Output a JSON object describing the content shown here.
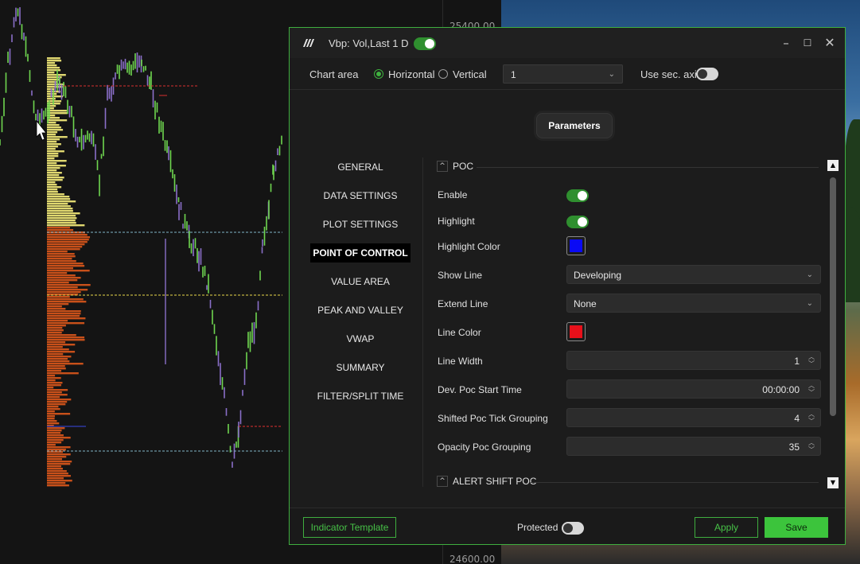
{
  "price_axis": {
    "top_label": "25400.00",
    "bottom_label": "24600.00"
  },
  "dialog": {
    "title": "Vbp: Vol,Last 1 D",
    "title_toggle_on": true,
    "window_controls": {
      "minimize": "–",
      "maximize": "☐",
      "close": "✕"
    },
    "chart_area": {
      "label": "Chart area",
      "orientation_options": [
        "Horizontal",
        "Vertical"
      ],
      "selected_orientation": "Horizontal",
      "area_select_value": "1",
      "use_sec_axis_label": "Use sec. axis",
      "use_sec_axis_on": false
    },
    "parameters_button": "Parameters",
    "nav": {
      "items": [
        "GENERAL",
        "DATA SETTINGS",
        "PLOT SETTINGS",
        "POINT OF CONTROL",
        "VALUE AREA",
        "PEAK AND VALLEY",
        "VWAP",
        "SUMMARY",
        "FILTER/SPLIT TIME"
      ],
      "active": "POINT OF CONTROL"
    },
    "poc_section": {
      "title": "POC",
      "enable": {
        "label": "Enable",
        "on": true
      },
      "highlight": {
        "label": "Highlight",
        "on": true
      },
      "highlight_color": {
        "label": "Highlight Color",
        "color": "#0a0af5"
      },
      "show_line": {
        "label": "Show Line",
        "value": "Developing"
      },
      "extend_line": {
        "label": "Extend Line",
        "value": "None"
      },
      "line_color": {
        "label": "Line Color",
        "color": "#e8101a"
      },
      "line_width": {
        "label": "Line Width",
        "value": "1"
      },
      "dev_poc_start_time": {
        "label": "Dev. Poc Start Time",
        "value": "00:00:00"
      },
      "shifted_poc_tick_grouping": {
        "label": "Shifted Poc Tick Grouping",
        "value": "4"
      },
      "opacity_poc_grouping": {
        "label": "Opacity Poc Grouping",
        "value": "35"
      }
    },
    "alert_section": {
      "title": "ALERT SHIFT POC"
    },
    "footer": {
      "indicator_template": "Indicator Template",
      "protected_label": "Protected",
      "protected_on": false,
      "apply": "Apply",
      "save": "Save"
    }
  },
  "colors": {
    "accent_green": "#3fae3f",
    "save_green": "#3cc43c",
    "profile_yellow": "#e0d870",
    "profile_orange": "#c8501a",
    "candle_green": "#6fd64f",
    "candle_purple": "#8a6fc9"
  },
  "icons": {
    "app_logo": "ninja-logo-icon",
    "dropdown": "chevron-down-icon",
    "spinner": "spinner-arrows-icon",
    "collapse": "chevron-up-icon"
  }
}
